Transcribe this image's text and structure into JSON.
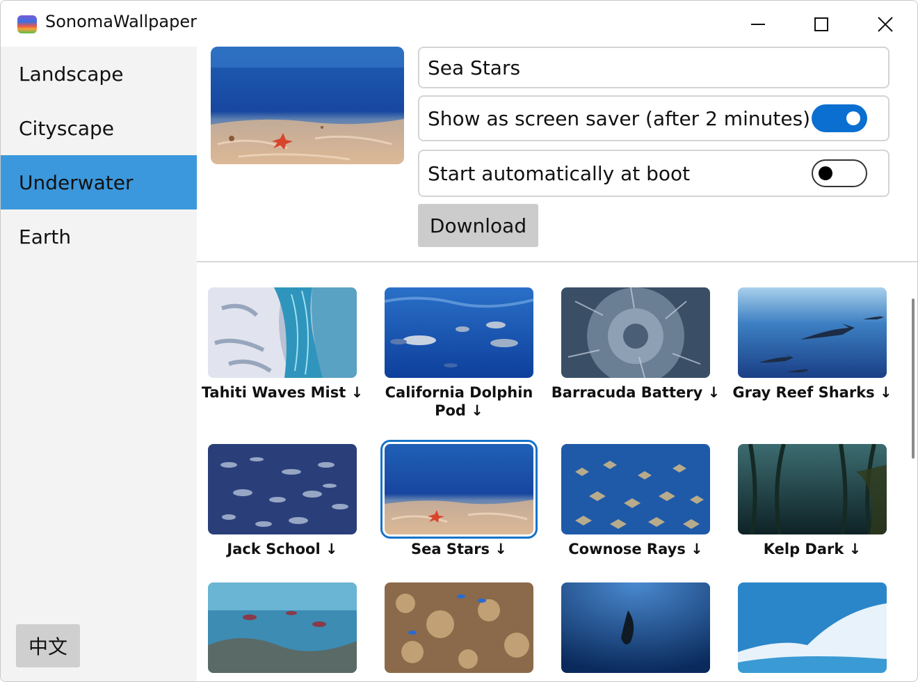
{
  "app": {
    "title": "SonomaWallpaper",
    "icon": "sonoma-app-icon"
  },
  "window_controls": {
    "minimize_icon": "minimize-icon",
    "maximize_icon": "maximize-icon",
    "close_icon": "close-icon"
  },
  "sidebar": {
    "items": [
      {
        "label": "Landscape",
        "active": false
      },
      {
        "label": "Cityscape",
        "active": false
      },
      {
        "label": "Underwater",
        "active": true
      },
      {
        "label": "Earth",
        "active": false
      }
    ],
    "language_button": "中文",
    "active_color": "#3c98dc"
  },
  "detail": {
    "name_value": "Sea Stars",
    "screensaver_label": "Show as screen saver (after 2 minutes)",
    "screensaver_on": true,
    "boot_label": "Start automatically at boot",
    "boot_on": false,
    "download_label": "Download",
    "accent_color": "#0a6fd0"
  },
  "gallery": {
    "items": [
      {
        "title": "Tahiti Waves Mist ↓"
      },
      {
        "title": "California Dolphin Pod ↓"
      },
      {
        "title": "Barracuda Battery ↓"
      },
      {
        "title": "Gray Reef Sharks ↓"
      },
      {
        "title": "Jack School ↓"
      },
      {
        "title": "Sea Stars ↓",
        "selected": true
      },
      {
        "title": "Cownose Rays ↓"
      },
      {
        "title": "Kelp Dark ↓"
      }
    ]
  }
}
